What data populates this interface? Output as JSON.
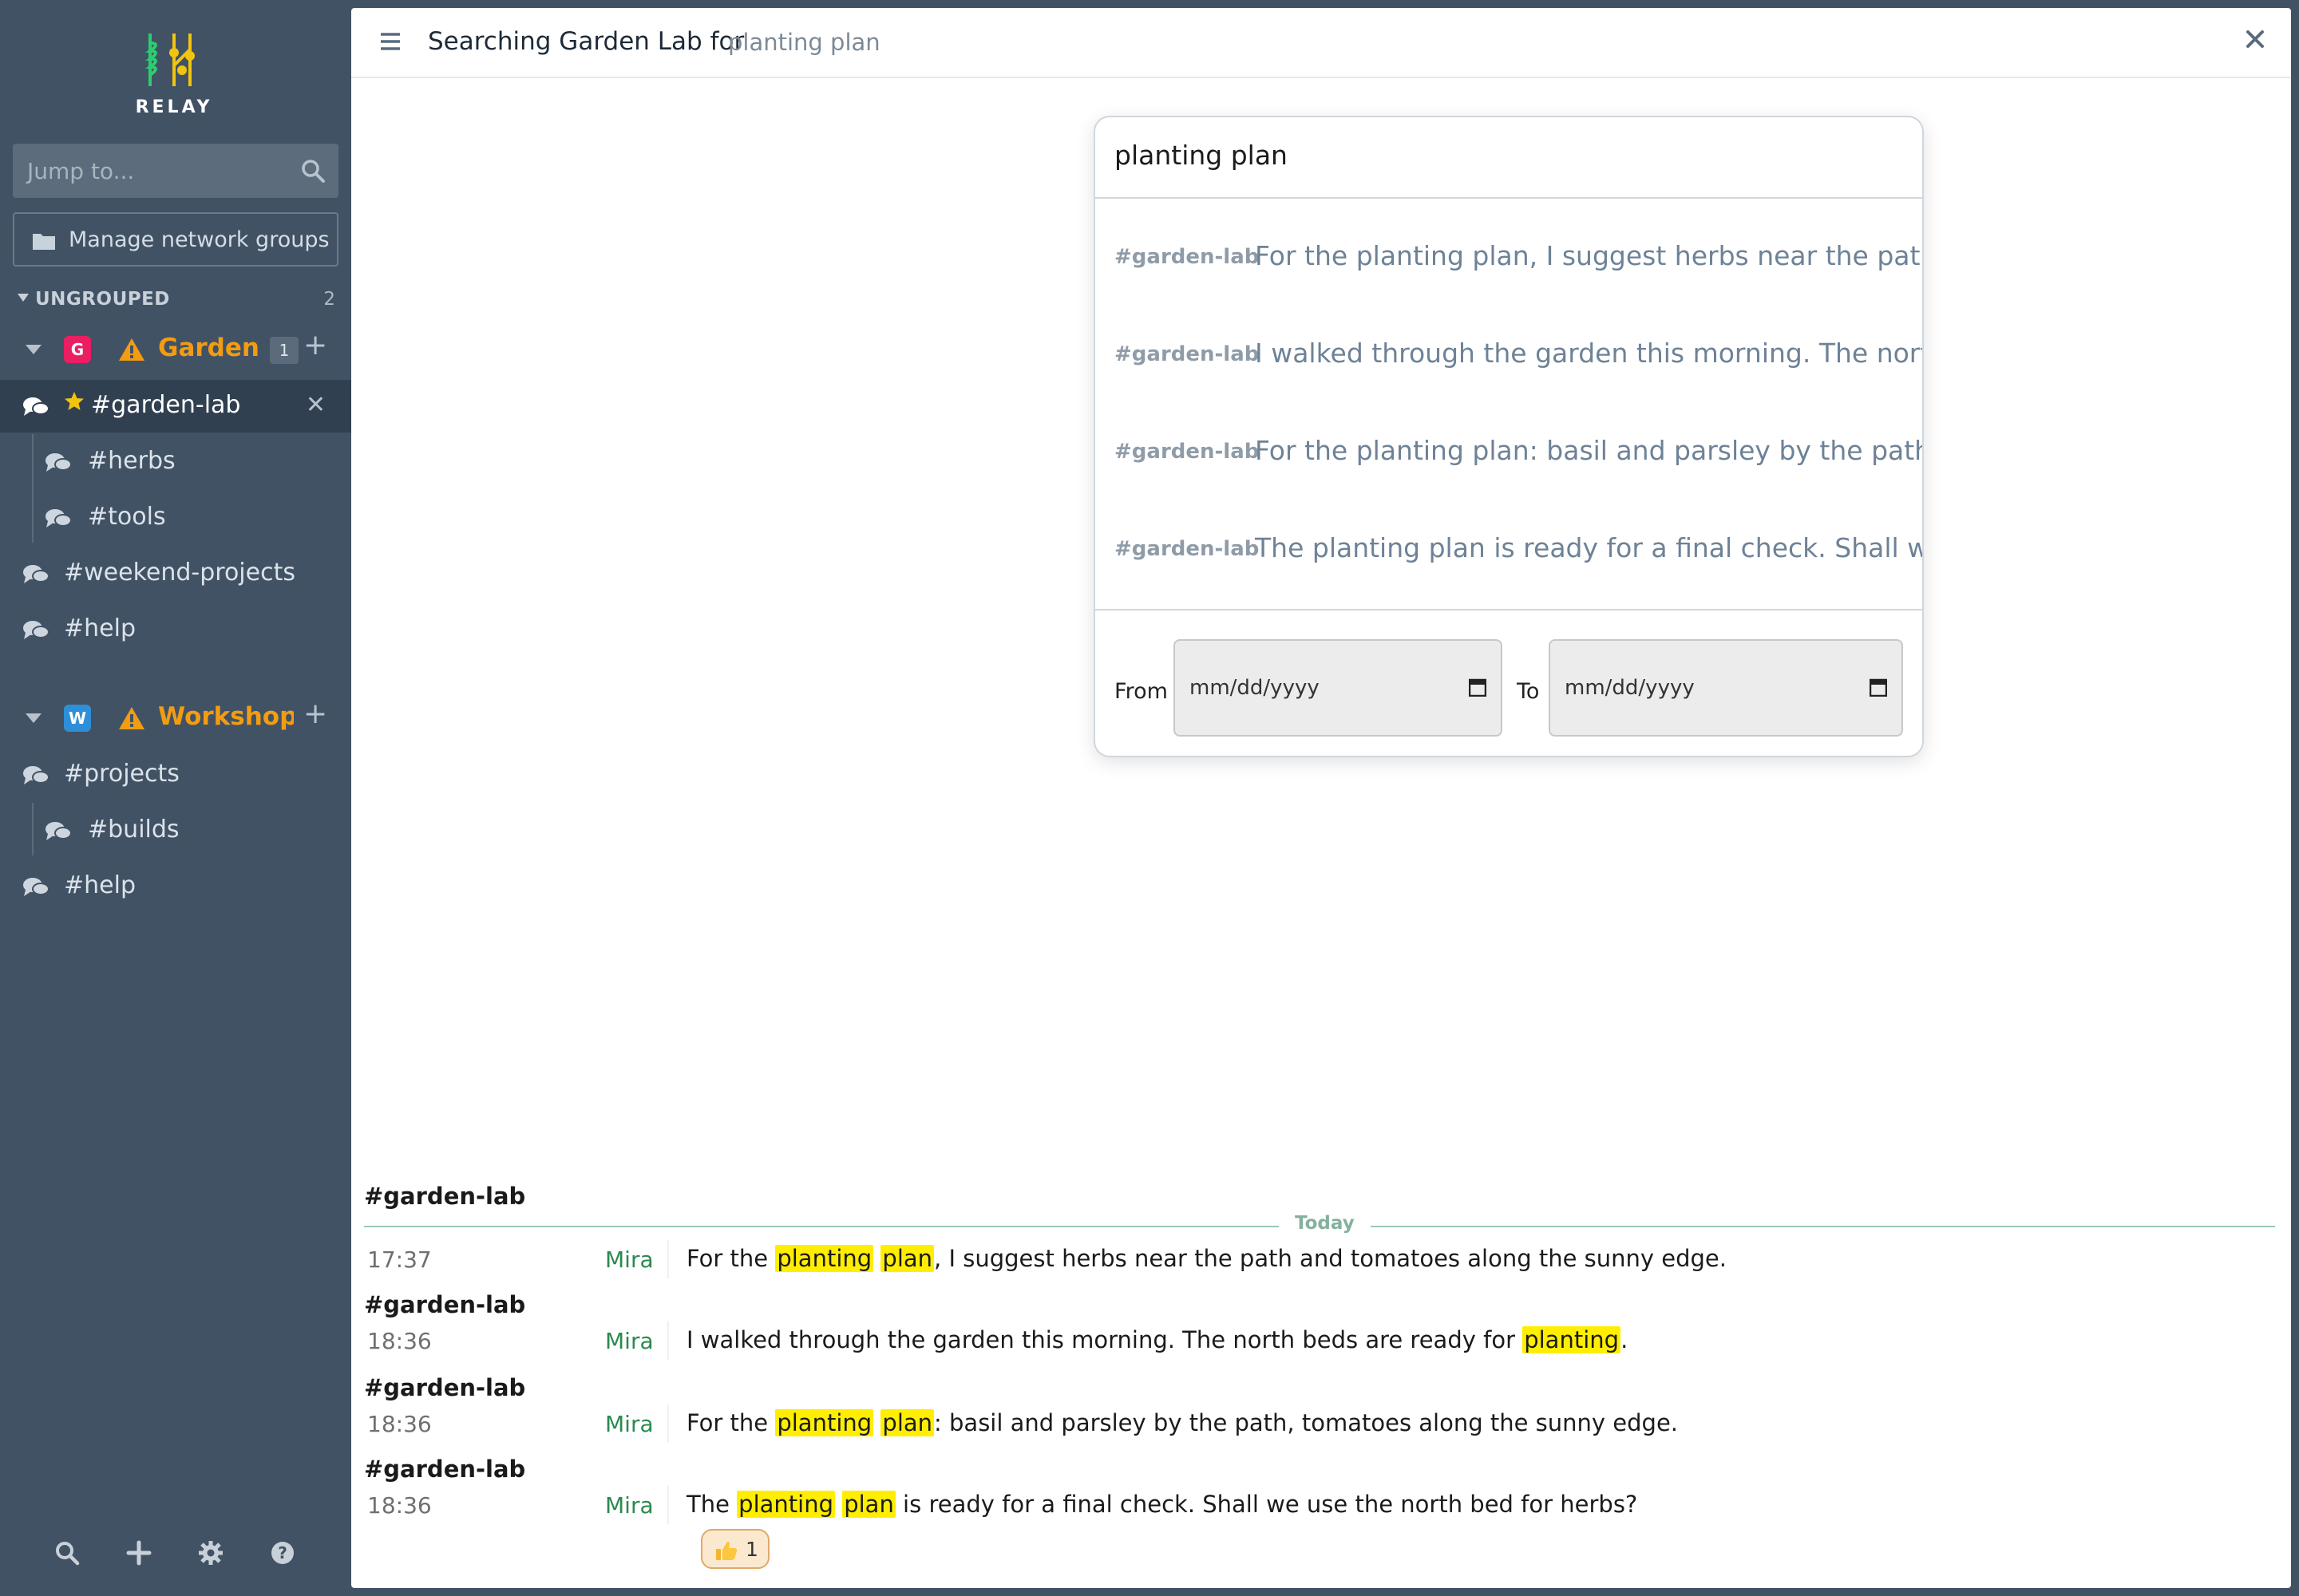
{
  "app": {
    "name": "RELAY"
  },
  "sidebar": {
    "jump_placeholder": "Jump to...",
    "manage_groups": "Manage network groups",
    "ungrouped_label": "UNGROUPED",
    "ungrouped_count": "2",
    "networks": [
      {
        "initial": "G",
        "name": "Garden Lab",
        "badge": "1",
        "color": "#e91e63",
        "channels": [
          {
            "label": "#garden-lab",
            "starred": true,
            "active": true
          },
          {
            "label": "#herbs"
          },
          {
            "label": "#tools"
          },
          {
            "label": "#weekend-projects"
          },
          {
            "label": "#help"
          }
        ]
      },
      {
        "initial": "W",
        "name": "Workshop",
        "color": "#2e8fd8",
        "channels": [
          {
            "label": "#projects"
          },
          {
            "label": "#builds"
          },
          {
            "label": "#help"
          }
        ]
      }
    ],
    "footer_icons": [
      "search-icon",
      "plus-icon",
      "gear-icon",
      "help-icon"
    ]
  },
  "header": {
    "title": "Searching Garden Lab for",
    "term": "planting plan"
  },
  "search_popup": {
    "query": "planting plan",
    "results": [
      {
        "channel": "#garden-lab",
        "text": "For the planting plan, I suggest herbs near the path and tomatoes along the sunny edge."
      },
      {
        "channel": "#garden-lab",
        "text": "I walked through the garden this morning. The north beds are ready for planting."
      },
      {
        "channel": "#garden-lab",
        "text": "For the planting plan: basil and parsley by the path, tomatoes along the sunny edge."
      },
      {
        "channel": "#garden-lab",
        "text": "The planting plan is ready for a final check. Shall we use the north bed for herbs?"
      }
    ],
    "from_label": "From",
    "to_label": "To",
    "date_placeholder": "mm/dd/yyyy"
  },
  "messages": {
    "day_label": "Today",
    "items": [
      {
        "channel": "#garden-lab",
        "time": "17:37",
        "author": "Mira",
        "parts": [
          "For the ",
          "planting",
          " ",
          "plan",
          ", I suggest herbs near the path and tomatoes along the sunny edge."
        ]
      },
      {
        "channel": "#garden-lab",
        "time": "18:36",
        "author": "Mira",
        "parts": [
          "I walked through the garden this morning. The north beds are ready for ",
          "planting",
          "."
        ]
      },
      {
        "channel": "#garden-lab",
        "time": "18:36",
        "author": "Mira",
        "parts": [
          "For the ",
          "planting",
          " ",
          "plan",
          ": basil and parsley by the path, tomatoes along the sunny edge."
        ]
      },
      {
        "channel": "#garden-lab",
        "time": "18:36",
        "author": "Mira",
        "parts": [
          "The ",
          "planting",
          " ",
          "plan",
          " is ready for a final check. Shall we use the north bed for herbs?"
        ]
      }
    ],
    "reaction": {
      "emoji": "thumbs-up-icon",
      "count": "1"
    }
  },
  "colors": {
    "accent": "#f39c12",
    "highlight": "#ffee00",
    "author": "#2b8a4f",
    "sidebar": "#415264"
  }
}
